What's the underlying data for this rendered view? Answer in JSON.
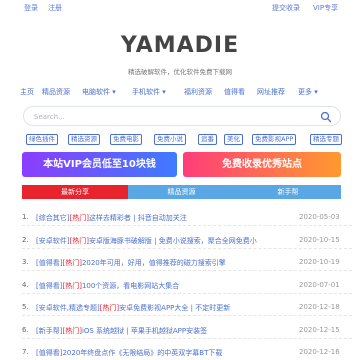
{
  "topbar": {
    "login": "登录",
    "register": "注册",
    "submit": "提交收录",
    "vip": "VIP专享"
  },
  "site": {
    "logo": "YAMADIE",
    "tagline": "精选破解软件，优化软件免费下载网"
  },
  "nav": [
    "主页",
    "精品资源",
    "电脑软件 ▾",
    "手机软件 ▾",
    "福利资源",
    "值得看",
    "网址推荐",
    "更多 ▾"
  ],
  "search": {
    "placeholder": "Search..."
  },
  "tags": [
    "绿色插件",
    "精选资源",
    "免费电影",
    "免费小说",
    "追番",
    "美化",
    "免费影视APP",
    "精选专题"
  ],
  "banners": {
    "left": "本站VIP会员低至10块钱",
    "right": "免费收录优秀站点"
  },
  "tabs": [
    "最新分享",
    "精品资源",
    "新手帮"
  ],
  "articles": [
    {
      "num": "1.",
      "category": "[综合其它]",
      "hot": "[热门]",
      "text": "这样去精彩者 | 抖音自动加关注",
      "date": "2020-05-03"
    },
    {
      "num": "2.",
      "category": "[安卓软件]",
      "hot": "[热门]",
      "text": "安卓版海豚书破解版 | 免费小说搜索，聚合全网免费小",
      "date": "2020-10-15"
    },
    {
      "num": "3.",
      "category": "[值得看]",
      "hot": "[热门]",
      "text": "2020年可用，好用，值得推荐的磁力搜索引擎",
      "date": "2020-10-19"
    },
    {
      "num": "4.",
      "category": "[值得看]",
      "hot": "[热门]",
      "text": "100个资源，看电影网站大集合",
      "date": "2020-07-01"
    },
    {
      "num": "5.",
      "category": "[安卓软件,精选专题]",
      "hot": "[热门]",
      "text": "安卓免费影视APP大全 | 不定时更新",
      "date": "2020-12-18"
    },
    {
      "num": "6.",
      "category": "[新手帮]",
      "hot": "[热门]",
      "text": "iOS 系统越狱 | 苹果手机越狱APP安装签",
      "date": "2020-12-15"
    },
    {
      "num": "7.",
      "category": "[值得看]",
      "hot": "",
      "text": "2020年终盘点作《无限结局》的中英双字幕BT下载",
      "date": "2020-12-16"
    }
  ],
  "colors": {
    "link": "#4a6fd1",
    "hot": "#e8232e",
    "tab_active": "#e8232e",
    "tab_inactive": "#5aa7e6"
  }
}
